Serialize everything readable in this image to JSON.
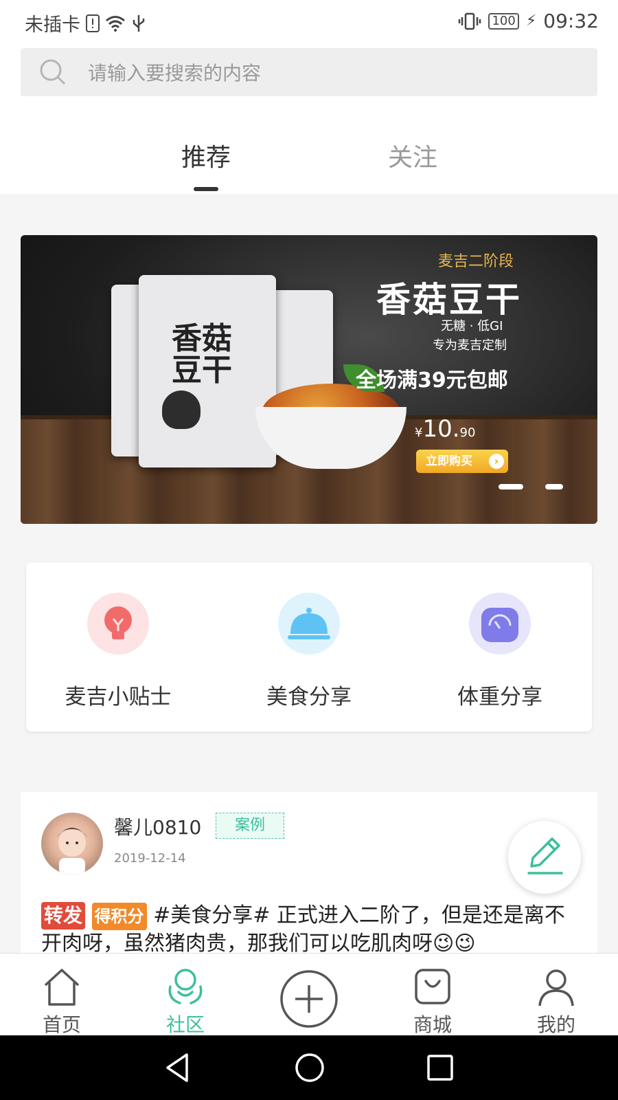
{
  "status_bar": {
    "carrier": "未插卡",
    "battery": "100",
    "time": "09:32"
  },
  "search": {
    "placeholder": "请输入要搜索的内容"
  },
  "tabs": [
    {
      "label": "推荐",
      "active": true
    },
    {
      "label": "关注",
      "active": false
    }
  ],
  "banner": {
    "stage": "麦吉二阶段",
    "title": "香菇豆干",
    "subtitle1": "无糖 · 低GI",
    "subtitle2": "专为麦吉定制",
    "promo": "全场满39元包邮",
    "price_currency": "¥",
    "price_main": "10.",
    "price_cents": "90",
    "buy_label": "立即购买",
    "package_text": "香菇豆干",
    "page_count": 2,
    "current_page": 1
  },
  "categories": [
    {
      "label": "麦吉小贴士",
      "icon": "lightbulb-icon",
      "color": "#f26b6b",
      "bg": "#fde3e3"
    },
    {
      "label": "美食分享",
      "icon": "food-cloche-icon",
      "color": "#5ec3f2",
      "bg": "#dff3fd"
    },
    {
      "label": "体重分享",
      "icon": "scale-gauge-icon",
      "color": "#7f7be8",
      "bg": "#e6e5fb"
    }
  ],
  "post": {
    "username": "馨儿0810",
    "tag": "案例",
    "date": "2019-12-14",
    "badge1": "转发",
    "badge2": "得积分",
    "text": " #美食分享# 正式进入二阶了，但是还是离不开肉呀，虽然猪肉贵，那我们可以吃肌肉呀😉😉"
  },
  "bottom_nav": [
    {
      "label": "首页",
      "icon": "home-icon",
      "active": false
    },
    {
      "label": "社区",
      "icon": "community-icon",
      "active": true
    },
    {
      "label": "",
      "icon": "add-icon",
      "active": false
    },
    {
      "label": "商城",
      "icon": "shop-bag-icon",
      "active": false
    },
    {
      "label": "我的",
      "icon": "profile-icon",
      "active": false
    }
  ],
  "colors": {
    "accent": "#3cbf9c",
    "text_primary": "#333333",
    "text_muted": "#999999"
  }
}
